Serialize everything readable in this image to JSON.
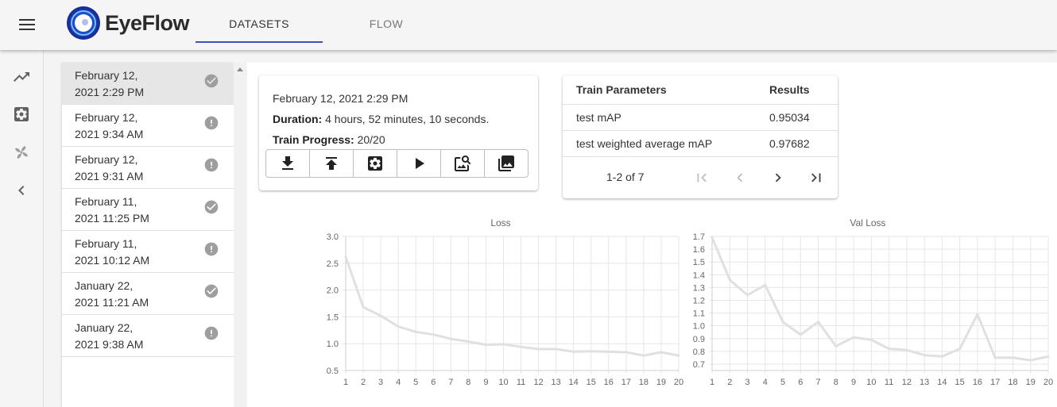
{
  "app": {
    "name": "EyeFlow",
    "tabs": [
      {
        "label": "DATASETS",
        "active": true
      },
      {
        "label": "FLOW",
        "active": false
      }
    ]
  },
  "rail": {
    "icons": [
      "trending-up-icon",
      "settings-chip-icon",
      "pinwheel-icon",
      "chevron-left-icon"
    ]
  },
  "datasets": [
    {
      "line1": "February 12,",
      "line2": "2021 2:29 PM",
      "status": "success",
      "selected": true
    },
    {
      "line1": "February 12,",
      "line2": "2021 9:34 AM",
      "status": "error",
      "selected": false
    },
    {
      "line1": "February 12,",
      "line2": "2021 9:31 AM",
      "status": "error",
      "selected": false
    },
    {
      "line1": "February 11,",
      "line2": "2021 11:25 PM",
      "status": "success",
      "selected": false
    },
    {
      "line1": "February 11,",
      "line2": "2021 10:12 AM",
      "status": "error",
      "selected": false
    },
    {
      "line1": "January 22,",
      "line2": "2021 11:21 AM",
      "status": "success",
      "selected": false
    },
    {
      "line1": "January 22,",
      "line2": "2021 9:38 AM",
      "status": "error",
      "selected": false
    }
  ],
  "info": {
    "date": "February 12, 2021 2:29 PM",
    "duration_label": "Duration:",
    "duration_value": "4 hours, 52 minutes, 10 seconds.",
    "progress_label": "Train Progress:",
    "progress_value": "20/20",
    "actions": [
      "download-icon",
      "upload-icon",
      "settings-icon",
      "play-icon",
      "image-search-icon",
      "photo-library-icon"
    ]
  },
  "params": {
    "headers": [
      "Train Parameters",
      "Results"
    ],
    "rows": [
      {
        "param": "test mAP",
        "result": "0.95034"
      },
      {
        "param": "test weighted average mAP",
        "result": "0.97682"
      }
    ],
    "pagination": "1-2 of 7"
  },
  "chart_data": [
    {
      "type": "line",
      "title": "Loss",
      "x": [
        1,
        2,
        3,
        4,
        5,
        6,
        7,
        8,
        9,
        10,
        11,
        12,
        13,
        14,
        15,
        16,
        17,
        18,
        19,
        20
      ],
      "series": [
        {
          "values": [
            2.62,
            1.68,
            1.52,
            1.32,
            1.22,
            1.17,
            1.09,
            1.04,
            0.98,
            0.99,
            0.94,
            0.9,
            0.9,
            0.85,
            0.86,
            0.85,
            0.84,
            0.78,
            0.84,
            0.78
          ]
        }
      ],
      "ylim": [
        0.5,
        3.0
      ],
      "yticks": [
        "0.5",
        "1.0",
        "1.5",
        "2.0",
        "2.5",
        "3.0"
      ],
      "grid": true,
      "color": "#e0e0e0"
    },
    {
      "type": "line",
      "title": "Val Loss",
      "x": [
        1,
        2,
        3,
        4,
        5,
        6,
        7,
        8,
        9,
        10,
        11,
        12,
        13,
        14,
        15,
        16,
        17,
        18,
        19,
        20
      ],
      "series": [
        {
          "values": [
            1.69,
            1.36,
            1.24,
            1.32,
            1.03,
            0.93,
            1.03,
            0.84,
            0.91,
            0.89,
            0.82,
            0.81,
            0.77,
            0.76,
            0.82,
            1.09,
            0.75,
            0.75,
            0.73,
            0.76
          ]
        }
      ],
      "ylim": [
        0.65,
        1.7
      ],
      "yticks": [
        "0.7",
        "0.8",
        "0.9",
        "1.0",
        "1.1",
        "1.2",
        "1.3",
        "1.4",
        "1.5",
        "1.6",
        "1.7"
      ],
      "grid": true,
      "color": "#e0e0e0"
    }
  ]
}
